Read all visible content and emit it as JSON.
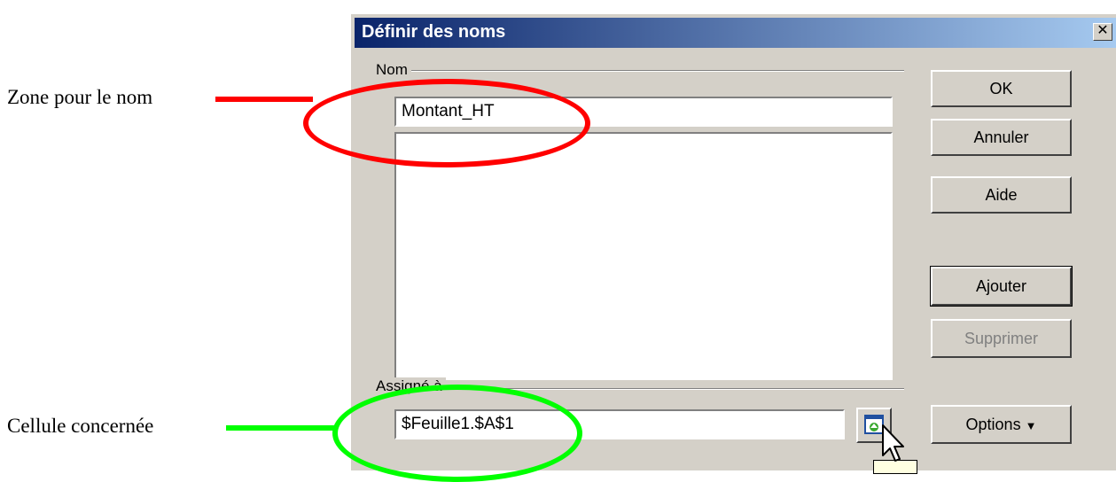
{
  "annotations": {
    "name_zone": "Zone pour le nom",
    "cell_concerned": "Cellule concernée"
  },
  "dialog": {
    "title": "Définir des noms",
    "close_symbol": "✕",
    "name_group_label": "Nom",
    "name_value": "Montant_HT",
    "assigned_group_label": "Assigné à",
    "assigned_value": "$Feuille1.$A$1",
    "buttons": {
      "ok": "OK",
      "cancel": "Annuler",
      "help": "Aide",
      "add": "Ajouter",
      "delete": "Supprimer",
      "options": "Options",
      "options_arrow": "▼"
    }
  },
  "colors": {
    "title_bar_start": "#0a246a",
    "title_bar_end": "#a6caf0",
    "dialog_bg": "#d4d0c8",
    "highlight_red": "#ff0000",
    "highlight_green": "#00ff00"
  }
}
